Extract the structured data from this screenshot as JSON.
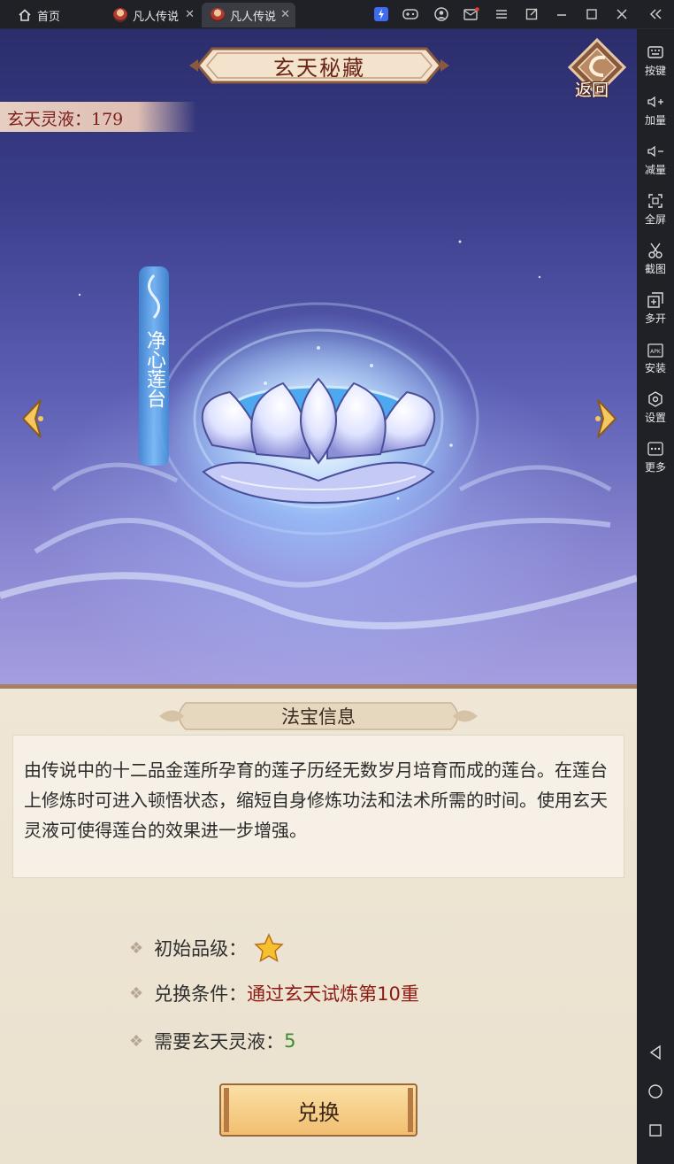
{
  "topbar": {
    "home_label": "首页",
    "tab1_label": "凡人传说",
    "tab2_label": "凡人传说",
    "close_glyph": "✕",
    "icons": [
      "lightning-icon",
      "gamepad-icon",
      "user-icon",
      "mail-icon",
      "menu-icon",
      "window-icon",
      "minimize-icon",
      "maximize-icon",
      "close-icon",
      "collapse-icon"
    ]
  },
  "sidebar": {
    "items": [
      {
        "label": "按键",
        "icon": "keyboard-icon"
      },
      {
        "label": "加量",
        "icon": "volume-up-icon"
      },
      {
        "label": "减量",
        "icon": "volume-down-icon"
      },
      {
        "label": "全屏",
        "icon": "fullscreen-icon"
      },
      {
        "label": "截图",
        "icon": "scissors-icon"
      },
      {
        "label": "多开",
        "icon": "multi-instance-icon"
      },
      {
        "label": "安装",
        "icon": "apk-install-icon"
      },
      {
        "label": "设置",
        "icon": "settings-icon"
      },
      {
        "label": "更多",
        "icon": "more-icon"
      }
    ],
    "nav": [
      "back-triangle-icon",
      "home-circle-icon",
      "recent-square-icon"
    ]
  },
  "game": {
    "title": "玄天秘藏",
    "back_label": "返回",
    "resource": "玄天灵液：179",
    "treasure_name": "净心莲台",
    "info_title": "法宝信息",
    "description": "由传说中的十二品金莲所孕育的莲子历经无数岁月培育而成的莲台。在莲台上修炼时可进入顿悟状态，缩短自身修炼功法和法术所需的时间。使用玄天灵液可使得莲台的效果进一步增强。",
    "attr_grade_label": "初始品级：",
    "attr_grade_stars": 1,
    "attr_cond_label": "兑换条件：",
    "attr_cond_value": "通过玄天试炼第10重",
    "attr_need_label": "需要玄天灵液：",
    "attr_need_value": "5",
    "exchange_label": "兑换",
    "colors": {
      "red": "#8e1a14",
      "green": "#3d8b2f",
      "brown": "#6a2418"
    }
  }
}
